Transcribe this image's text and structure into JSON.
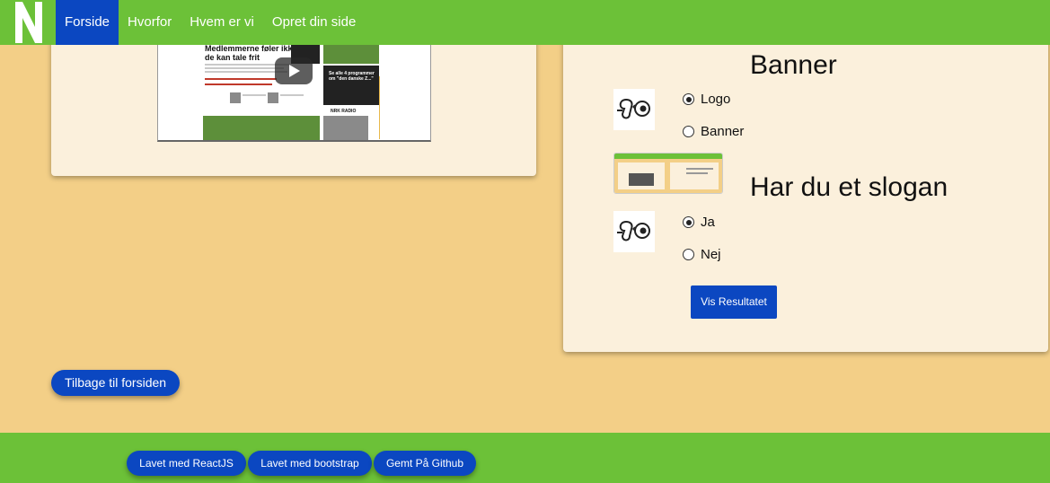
{
  "navbar": {
    "brand_icon": "n-logo-icon",
    "items": [
      {
        "label": "Forside",
        "active": true
      },
      {
        "label": "Hvorfor",
        "active": false
      },
      {
        "label": "Hvem er vi",
        "active": false
      },
      {
        "label": "Opret din side",
        "active": false
      }
    ]
  },
  "video": {
    "headline": "Medlemmerne føler ikke, de kan tale frit",
    "radio_label": "NRK RADIO",
    "promo": "Se alle 4 programmer om \"den danske Z...\""
  },
  "survey": {
    "q1_title": "Banner",
    "q1_options": [
      {
        "label": "Logo",
        "checked": true
      },
      {
        "label": "Banner",
        "checked": false
      }
    ],
    "q2_title": "Har du et slogan",
    "q2_options": [
      {
        "label": "Ja",
        "checked": true
      },
      {
        "label": "Nej",
        "checked": false
      }
    ],
    "result_button": "Vis Resultatet",
    "option_icon": "ear-icon"
  },
  "back_button": "Tilbage til forsiden",
  "footer": {
    "badges": [
      "Lavet med ReactJS",
      "Lavet med bootstrap",
      "Gemt På Github"
    ]
  },
  "colors": {
    "nav_green": "#6cc138",
    "primary_blue": "#0b47c1",
    "page_bg": "#f3cf87",
    "card_bg": "#fbf0dc"
  }
}
